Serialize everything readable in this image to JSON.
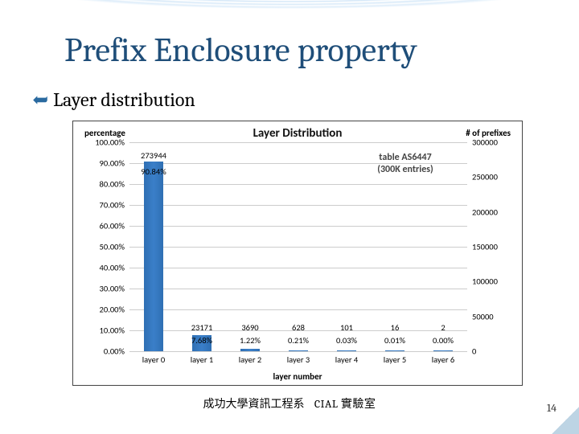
{
  "slide": {
    "title": "Prefix Enclosure property",
    "subtitle": "Layer distribution",
    "footer_left": "成功大學資訊工程系",
    "footer_right": "CIAL 實驗室",
    "page_number": "14"
  },
  "axis_left_label": "percentage",
  "axis_right_label": "# of prefixes",
  "xaxis_label": "layer number",
  "legend_line1": "table AS6447",
  "legend_line2": "(300K entries)",
  "chart_data": {
    "type": "bar",
    "title": "Layer Distribution",
    "categories": [
      "layer 0",
      "layer 1",
      "layer 2",
      "layer 3",
      "layer 4",
      "layer 5",
      "layer 6"
    ],
    "series": [
      {
        "name": "count",
        "values": [
          273944,
          23171,
          3690,
          628,
          101,
          16,
          2
        ],
        "axis": "right"
      },
      {
        "name": "percentage",
        "values": [
          90.84,
          7.68,
          1.22,
          0.21,
          0.03,
          0.01,
          0.0
        ],
        "axis": "left"
      }
    ],
    "ylabel_left": "percentage",
    "ylim_left": [
      0,
      100
    ],
    "yticks_left": [
      "0.00%",
      "10.00%",
      "20.00%",
      "30.00%",
      "40.00%",
      "50.00%",
      "60.00%",
      "70.00%",
      "80.00%",
      "90.00%",
      "100.00%"
    ],
    "ylabel_right": "# of prefixes",
    "ylim_right": [
      0,
      300000
    ],
    "yticks_right": [
      "0",
      "50000",
      "100000",
      "150000",
      "200000",
      "250000",
      "300000"
    ],
    "xlabel": "layer number",
    "legend_position": "top-right",
    "count_labels": [
      "273944",
      "23171",
      "3690",
      "628",
      "101",
      "16",
      "2"
    ],
    "pct_labels": [
      "90.84%",
      "7.68%",
      "1.22%",
      "0.21%",
      "0.03%",
      "0.01%",
      "0.00%"
    ]
  }
}
